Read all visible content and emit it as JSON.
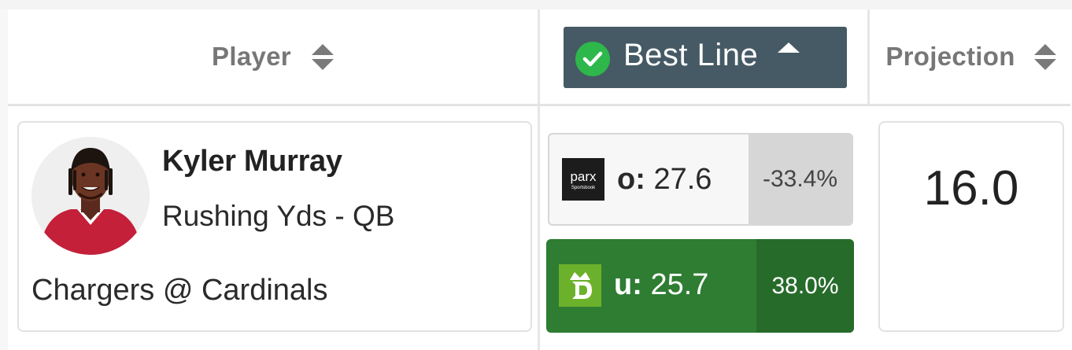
{
  "header": {
    "player_label": "Player",
    "best_line_label": "Best Line",
    "projection_label": "Projection"
  },
  "player": {
    "name": "Kyler Murray",
    "market": "Rushing Yds - QB",
    "game": "Chargers @ Cardinals",
    "avatar_icon": "player-headshot"
  },
  "lines": {
    "over": {
      "book_logo_text": "parx",
      "book_logo_subtext": "Sportsbook",
      "side": "o:",
      "value": "27.6",
      "percent": "-33.4%"
    },
    "under": {
      "book_icon": "draftkings-crown-icon",
      "side": "u:",
      "value": "25.7",
      "percent": "38.0%"
    }
  },
  "projection": {
    "value": "16.0"
  },
  "colors": {
    "best_line_bg": "#455a64",
    "check_green": "#2eb84b",
    "under_green": "#2e7d32",
    "under_pct_green": "#276b2b",
    "draftkings_green": "#6cb12b"
  }
}
